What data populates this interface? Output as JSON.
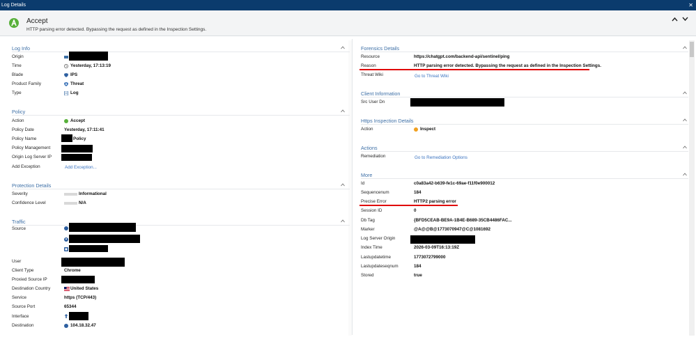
{
  "window": {
    "title": "Log Details",
    "close_icon": "close-icon"
  },
  "header": {
    "action": "Accept",
    "description": "HTTP parsing error detected. Bypassing the request as defined in the Inspection Settings."
  },
  "colors": {
    "accent": "#3d6fa6",
    "titlebar": "#0b3b6d",
    "accept": "#58b03a",
    "highlight": "#e00000",
    "link": "#3a73c0"
  },
  "log_info": {
    "title": "Log Info",
    "origin_label": "Origin",
    "time_label": "Time",
    "time_value": "Yesterday, 17:13:19",
    "blade_label": "Blade",
    "blade_value": "IPS",
    "product_family_label": "Product Family",
    "product_family_value": "Threat",
    "type_label": "Type",
    "type_value": "Log"
  },
  "policy": {
    "title": "Policy",
    "action_label": "Action",
    "action_value": "Accept",
    "date_label": "Policy Date",
    "date_value": "Yesterday, 17:11:41",
    "name_label": "Policy Name",
    "name_value": "Policy",
    "management_label": "Policy Management",
    "origin_ip_label": "Origin Log Server IP",
    "add_exception_label": "Add Exception",
    "add_exception_link": "Add Exception..."
  },
  "protection": {
    "title": "Protection Details",
    "severity_label": "Severity",
    "severity_value": "Informational",
    "confidence_label": "Confidence Level",
    "confidence_value": "N/A"
  },
  "traffic": {
    "title": "Traffic",
    "source_label": "Source",
    "user_label": "User",
    "client_type_label": "Client Type",
    "client_type_value": "Chrome",
    "proxied_label": "Proxied Source IP",
    "dest_country_label": "Destination Country",
    "dest_country_value": "United States",
    "service_label": "Service",
    "service_value": "https (TCP/443)",
    "source_port_label": "Source Port",
    "source_port_value": "65344",
    "interface_label": "Interface",
    "destination_label": "Destination",
    "destination_value": "104.18.32.47"
  },
  "forensics": {
    "title": "Forensics Details",
    "resource_label": "Resource",
    "resource_value": "https://chatgpt.com/backend-api/sentinel/ping",
    "reason_label": "Reason",
    "reason_value": "HTTP parsing error detected. Bypassing the request as defined in the Inspection Settings.",
    "threat_wiki_label": "Threat Wiki",
    "threat_wiki_link": "Go to Threat Wiki"
  },
  "client_info": {
    "title": "Client Information",
    "src_user_label": "Src User Dn"
  },
  "https_inspection": {
    "title": "Https Inspection Details",
    "action_label": "Action",
    "action_value": "Inspect"
  },
  "actions": {
    "title": "Actions",
    "remediation_label": "Remediation",
    "remediation_link": "Go to Remediation Options"
  },
  "more": {
    "title": "More",
    "rows": [
      {
        "label": "Id",
        "value": "c0a83a42-b639-fe1c-69ae-f11f0e900012"
      },
      {
        "label": "Sequencenum",
        "value": "184"
      },
      {
        "label": "Precise Error",
        "value": "HTTP2 parsing error"
      },
      {
        "label": "Session ID",
        "value": "0"
      },
      {
        "label": "Db Tag",
        "value": "{BFD5CEAB-BE9A-1B4E-B689-35CB4486FAC..."
      },
      {
        "label": "Marker",
        "value": "@A@@B@1773070947@C@1081692"
      },
      {
        "label": "Log Server Origin",
        "value": ""
      },
      {
        "label": "Index Time",
        "value": "2026-03-09T16:13:19Z"
      },
      {
        "label": "Lastupdatetime",
        "value": "1773072799000"
      },
      {
        "label": "Lastupdateseqnum",
        "value": "184"
      },
      {
        "label": "Stored",
        "value": "true"
      }
    ]
  }
}
